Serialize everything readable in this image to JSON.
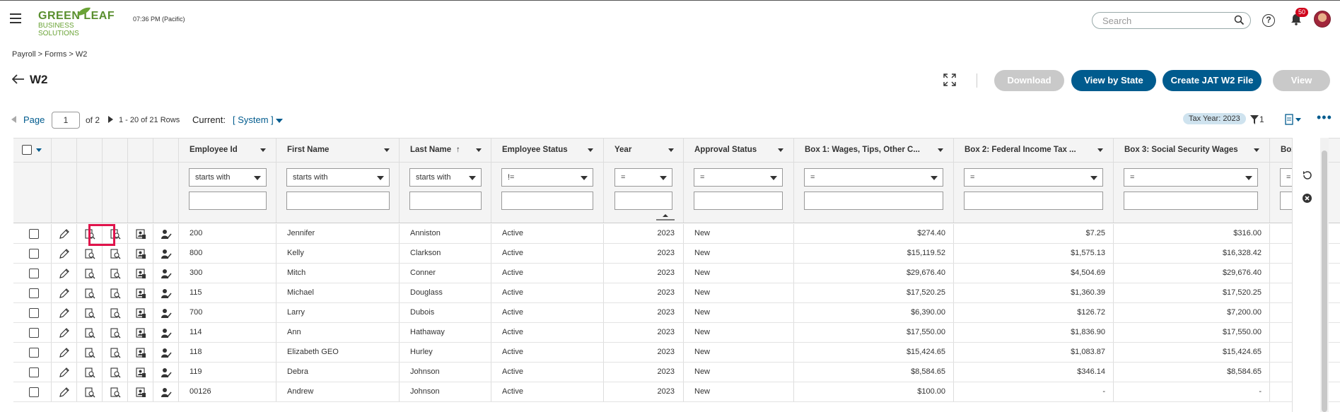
{
  "header": {
    "logo_line1": "GREEN LEAF",
    "logo_line2": "BUSINESS SOLUTIONS",
    "clock": "07:36 PM (Pacific)",
    "search_placeholder": "Search",
    "help_label": "?",
    "notification_count": "50"
  },
  "breadcrumb": "Payroll > Forms > W2",
  "page": {
    "title": "W2"
  },
  "actions": {
    "download": "Download",
    "view_by_state": "View by State",
    "create_jat": "Create JAT W2 File",
    "view": "View"
  },
  "pager": {
    "label": "Page",
    "current_page": "1",
    "of_text": "of 2",
    "rows_text": "1 - 20 of 21 Rows",
    "current_label": "Current:",
    "current_value": "[ System ]"
  },
  "toolbar": {
    "tax_year": "Tax Year: 2023",
    "filter_count": "1",
    "more": "•••"
  },
  "columns": [
    {
      "label": "Employee Id",
      "filter": "starts with"
    },
    {
      "label": "First Name",
      "filter": "starts with"
    },
    {
      "label": "Last Name",
      "filter": "starts with",
      "sort": "↑"
    },
    {
      "label": "Employee Status",
      "filter": "!="
    },
    {
      "label": "Year",
      "filter": "="
    },
    {
      "label": "Approval Status",
      "filter": "="
    },
    {
      "label": "Box 1: Wages, Tips, Other C...",
      "filter": "="
    },
    {
      "label": "Box 2: Federal Income Tax ...",
      "filter": "="
    },
    {
      "label": "Box 3: Social Security Wages",
      "filter": "="
    },
    {
      "label": "Box",
      "filter": "="
    }
  ],
  "rows": [
    {
      "id": "200",
      "first": "Jennifer",
      "last": "Anniston",
      "status": "Active",
      "year": "2023",
      "approval": "New",
      "box1": "$274.40",
      "box2": "$7.25",
      "box3": "$316.00"
    },
    {
      "id": "800",
      "first": "Kelly",
      "last": "Clarkson",
      "status": "Active",
      "year": "2023",
      "approval": "New",
      "box1": "$15,119.52",
      "box2": "$1,575.13",
      "box3": "$16,328.42"
    },
    {
      "id": "300",
      "first": "Mitch",
      "last": "Conner",
      "status": "Active",
      "year": "2023",
      "approval": "New",
      "box1": "$29,676.40",
      "box2": "$4,504.69",
      "box3": "$29,676.40"
    },
    {
      "id": "115",
      "first": "Michael",
      "last": "Douglass",
      "status": "Active",
      "year": "2023",
      "approval": "New",
      "box1": "$17,520.25",
      "box2": "$1,360.39",
      "box3": "$17,520.25"
    },
    {
      "id": "700",
      "first": "Larry",
      "last": "Dubois",
      "status": "Active",
      "year": "2023",
      "approval": "New",
      "box1": "$6,390.00",
      "box2": "$126.72",
      "box3": "$7,200.00"
    },
    {
      "id": "114",
      "first": "Ann",
      "last": "Hathaway",
      "status": "Active",
      "year": "2023",
      "approval": "New",
      "box1": "$17,550.00",
      "box2": "$1,836.90",
      "box3": "$17,550.00"
    },
    {
      "id": "118",
      "first": "Elizabeth GEO",
      "last": "Hurley",
      "status": "Active",
      "year": "2023",
      "approval": "New",
      "box1": "$15,424.65",
      "box2": "$1,083.87",
      "box3": "$15,424.65"
    },
    {
      "id": "119",
      "first": "Debra",
      "last": "Johnson",
      "status": "Active",
      "year": "2023",
      "approval": "New",
      "box1": "$8,584.65",
      "box2": "$346.14",
      "box3": "$8,584.65"
    },
    {
      "id": "00126",
      "first": "Andrew",
      "last": "Johnson",
      "status": "Active",
      "year": "2023",
      "approval": "New",
      "box1": "$100.00",
      "box2": "-",
      "box3": "-"
    }
  ],
  "colors": {
    "primary": "#005b8e",
    "disabled": "#c9c9c9",
    "highlight": "#e0134b",
    "logo": "#5a8f2f"
  },
  "icons": [
    "hamburger-icon",
    "search-icon",
    "help-icon",
    "bell-icon",
    "back-arrow-icon",
    "expand-icon",
    "edit-icon",
    "preview-icon",
    "view-doc-icon",
    "employee-doc-icon",
    "assign-user-icon",
    "filter-icon",
    "export-icon",
    "reset-icon",
    "clear-icon"
  ]
}
